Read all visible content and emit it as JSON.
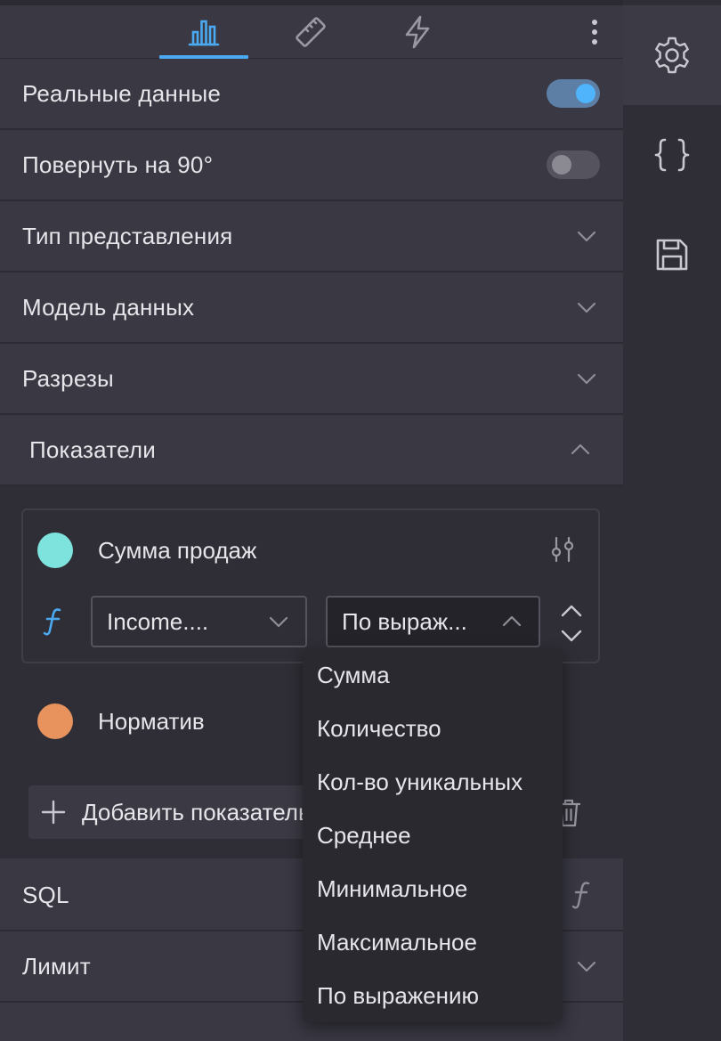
{
  "toggles": {
    "real_data": {
      "label": "Реальные данные",
      "on": true
    },
    "rotate": {
      "label": "Повернуть на 90°",
      "on": false
    }
  },
  "sections": {
    "view_type": "Тип представления",
    "data_model": "Модель данных",
    "dimensions": "Разрезы",
    "metrics": "Показатели",
    "sql": "SQL",
    "limit": "Лимит"
  },
  "metrics": {
    "items": [
      {
        "name": "Сумма продаж",
        "color": "#7ee3dc"
      },
      {
        "name": "Норматив",
        "color": "#e8935d"
      }
    ],
    "field_select": "Income....",
    "agg_select": "По выраж...",
    "add_button": "Добавить показатель"
  },
  "aggregation_menu": {
    "options": [
      "Сумма",
      "Количество",
      "Кол-во уникальных",
      "Среднее",
      "Минимальное",
      "Максимальное",
      "По выражению"
    ]
  },
  "colors": {
    "accent": "#4aa9f0",
    "function_icon": "#4aa9f0"
  },
  "icons": {
    "tabs": [
      "bar-chart-icon",
      "ruler-icon",
      "lightning-icon"
    ],
    "rail": [
      "gear-icon",
      "braces-icon",
      "save-icon"
    ]
  }
}
